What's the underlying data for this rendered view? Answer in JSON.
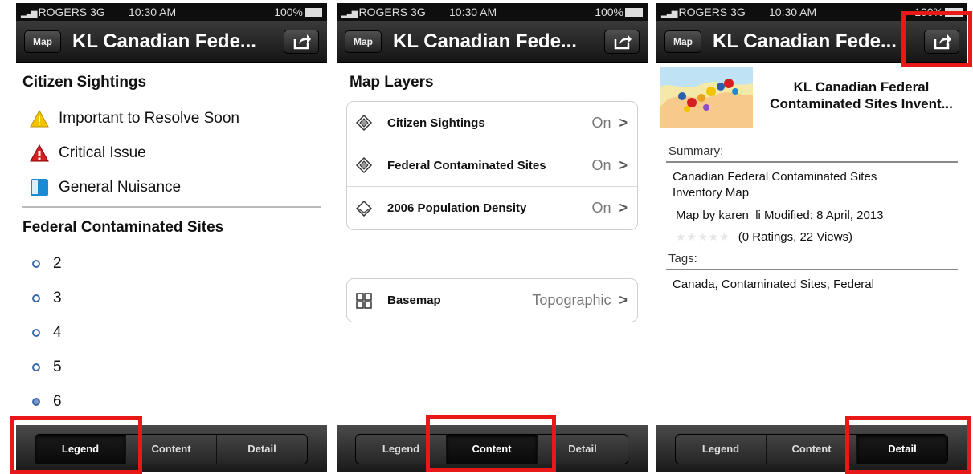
{
  "status": {
    "carrier": "ROGERS",
    "network": "3G",
    "time": "10:30 AM",
    "battery": "100%"
  },
  "nav": {
    "map_button": "Map",
    "title": "KL Canadian Fede..."
  },
  "tabs": {
    "legend": "Legend",
    "content": "Content",
    "detail": "Detail"
  },
  "legend_panel": {
    "section1_title": "Citizen Sightings",
    "items": [
      {
        "label": "Important to Resolve Soon",
        "icon": "warning-icon",
        "color": "#f2c400"
      },
      {
        "label": "Critical Issue",
        "icon": "critical-icon",
        "color": "#d42020"
      },
      {
        "label": "General Nuisance",
        "icon": "nuisance-icon",
        "color": "#1a8ad4"
      }
    ],
    "section2_title": "Federal Contaminated Sites",
    "values": [
      "2",
      "3",
      "4",
      "5",
      "6"
    ]
  },
  "content_panel": {
    "title": "Map Layers",
    "layers": [
      {
        "label": "Citizen Sightings",
        "state": "On"
      },
      {
        "label": "Federal Contaminated Sites",
        "state": "On"
      },
      {
        "label": "2006 Population Density",
        "state": "On"
      }
    ],
    "basemap_label": "Basemap",
    "basemap_value": "Topographic",
    "chevron": ">"
  },
  "detail_panel": {
    "title_line1": "KL Canadian Federal",
    "title_line2": "Contaminated Sites Invent...",
    "summary_label": "Summary:",
    "summary_line1": "Canadian Federal Contaminated Sites",
    "summary_line2": "Inventory Map",
    "byline": "Map by karen_li  Modified: 8 April, 2013",
    "ratings": "(0 Ratings, 22 Views)",
    "tags_label": "Tags:",
    "tags": "Canada, Contaminated Sites, Federal"
  },
  "colors": {
    "highlight": "#e81818",
    "navbar": "#1f1f1f",
    "dot_border": "#3b6aa8"
  }
}
